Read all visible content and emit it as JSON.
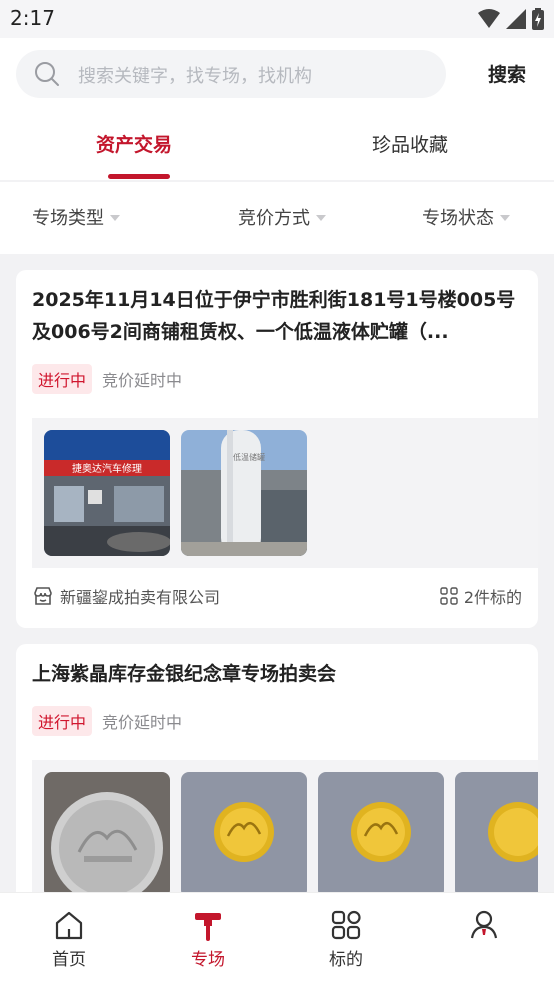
{
  "status_bar": {
    "time": "2:17"
  },
  "search": {
    "placeholder": "搜索关键字，找专场，找机构",
    "button_label": "搜索"
  },
  "tabs": [
    {
      "label": "资产交易",
      "active": true
    },
    {
      "label": "珍品收藏",
      "active": false
    }
  ],
  "filters": [
    {
      "label": "专场类型"
    },
    {
      "label": "竞价方式"
    },
    {
      "label": "专场状态"
    }
  ],
  "cards": [
    {
      "title": "2025年11月14日位于伊宁市胜利街181号1号楼005号及006号2间商铺租赁权、一个低温液体贮罐（...",
      "status": "进行中",
      "status_note": "竞价延时中",
      "company": "新疆鋆成拍卖有限公司",
      "lot_count": "2件标的",
      "images": [
        {
          "sign_text": "捷奥达汽车修理"
        },
        {
          "tank_text": "低温储罐"
        }
      ]
    },
    {
      "title": "上海紫晶库存金银纪念章专场拍卖会",
      "status": "进行中",
      "status_note": "竞价延时中",
      "images": [
        "silver-coin",
        "gold-coin",
        "gold-coin",
        "gold-coin"
      ]
    }
  ],
  "bottom_nav": [
    {
      "label": "首页",
      "icon": "home-icon",
      "active": false
    },
    {
      "label": "专场",
      "icon": "gavel-icon",
      "active": true
    },
    {
      "label": "标的",
      "icon": "grid-icon",
      "active": false
    },
    {
      "label": "",
      "icon": "user-icon",
      "active": false
    }
  ],
  "colors": {
    "accent": "#c3162c",
    "badge_bg": "#fde8ea",
    "badge_text": "#d0162e"
  }
}
